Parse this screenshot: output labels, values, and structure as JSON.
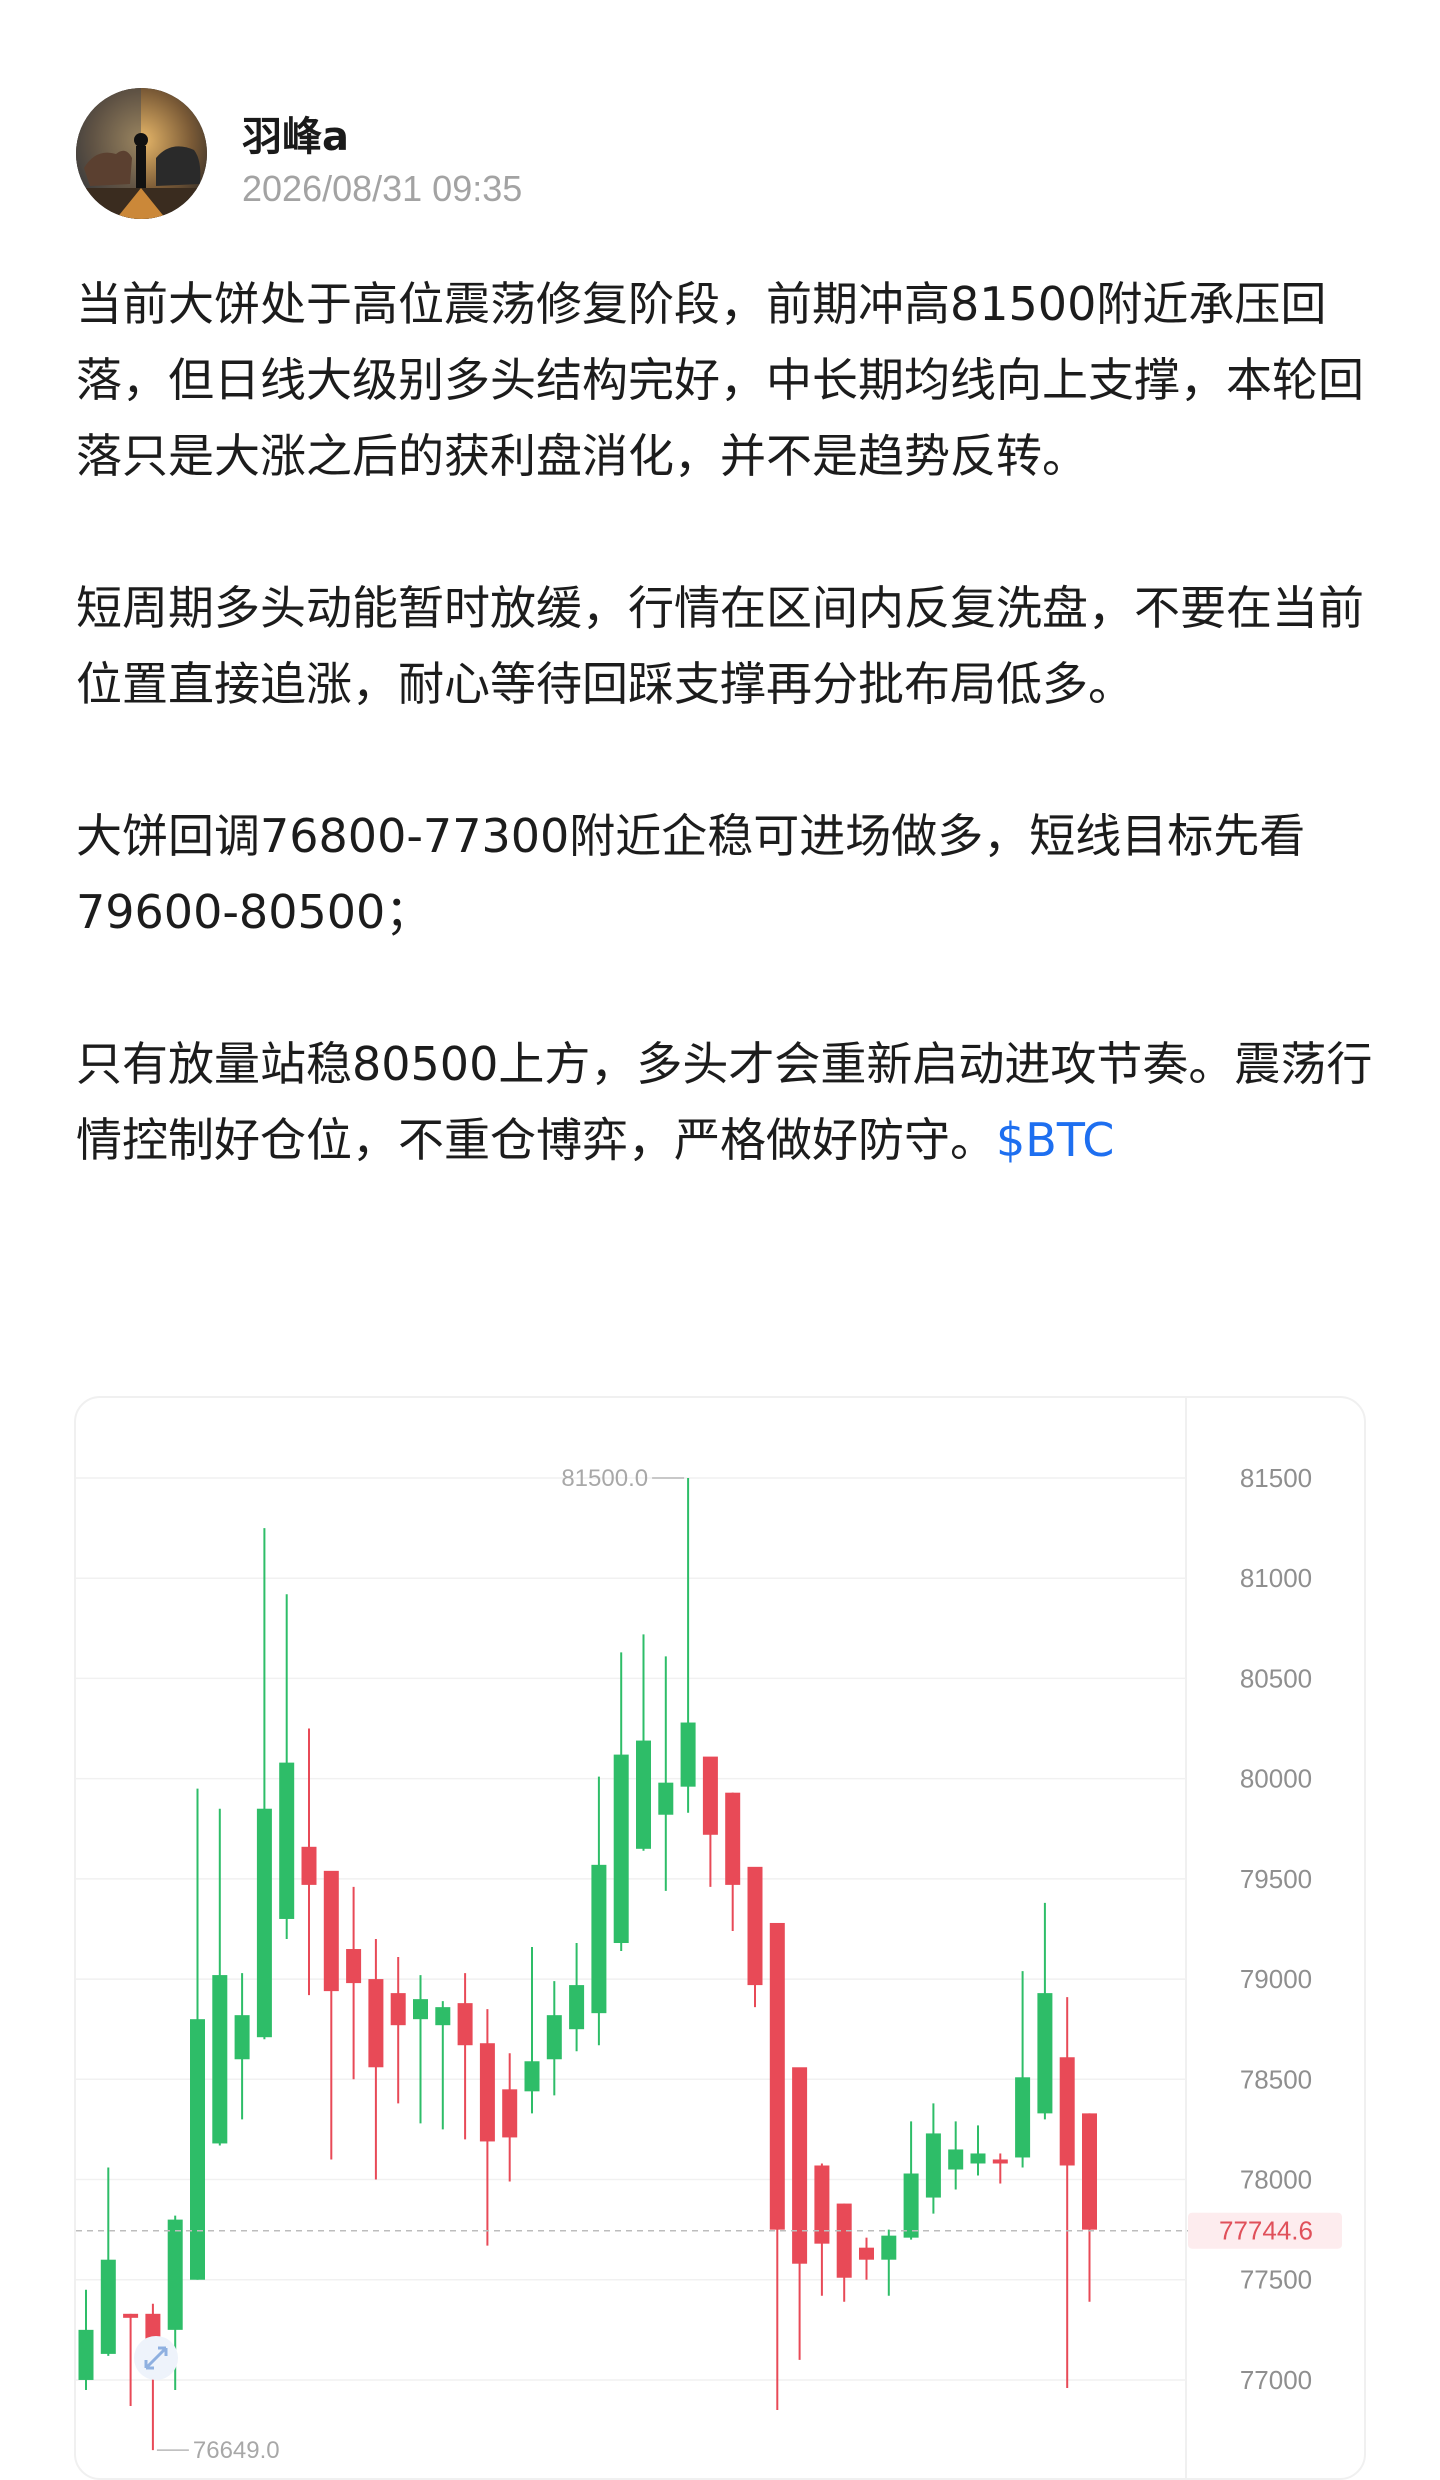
{
  "author": {
    "name": "羽峰a",
    "timestamp": "2026/08/31 09:35",
    "avatar_icon": "bull-and-bear-avatar"
  },
  "post": {
    "paragraphs": [
      "当前大饼处于高位震荡修复阶段，前期冲高81500附近承压回落，但日线大级别多头结构完好，中长期均线向上支撑，本轮回落只是大涨之后的获利盘消化，并不是趋势反转。",
      "短周期多头动能暂时放缓，行情在区间内反复洗盘，不要在当前位置直接追涨，耐心等待回踩支撑再分批布局低多。",
      "大饼回调76800-77300附近企稳可进场做多，短线目标先看79600-80500；",
      "只有放量站稳80500上方，多头才会重新启动进攻节奏。震荡行情控制好仓位，不重仓博弈，严格做好防守。"
    ],
    "tag": "$BTC"
  },
  "chart_data": {
    "type": "candlestick",
    "y_ticks": [
      "81500",
      "81000",
      "80500",
      "80000",
      "79500",
      "79000",
      "78500",
      "78000",
      "77500",
      "77000"
    ],
    "ylim": [
      76600,
      81700
    ],
    "high_marker": "81500.0",
    "low_marker": "76649.0",
    "last_price": "77744.6",
    "colors": {
      "up": "#2ebd68",
      "down": "#e84a57",
      "grid": "#f1f1f1",
      "last_line": "#bdbdbd"
    },
    "candles": [
      {
        "o": 77000,
        "h": 77450,
        "l": 76950,
        "c": 77250
      },
      {
        "o": 77130,
        "h": 78060,
        "l": 77120,
        "c": 77600
      },
      {
        "o": 77330,
        "h": 77330,
        "l": 76870,
        "c": 77310
      },
      {
        "o": 77330,
        "h": 77380,
        "l": 76650,
        "c": 77180
      },
      {
        "o": 77250,
        "h": 77820,
        "l": 76950,
        "c": 77800
      },
      {
        "o": 77500,
        "h": 79950,
        "l": 77500,
        "c": 78800
      },
      {
        "o": 78180,
        "h": 79850,
        "l": 78170,
        "c": 79020
      },
      {
        "o": 78600,
        "h": 79030,
        "l": 78300,
        "c": 78820
      },
      {
        "o": 78710,
        "h": 81250,
        "l": 78700,
        "c": 79850
      },
      {
        "o": 79300,
        "h": 80920,
        "l": 79200,
        "c": 80080
      },
      {
        "o": 79660,
        "h": 80250,
        "l": 78920,
        "c": 79470
      },
      {
        "o": 79540,
        "h": 79530,
        "l": 78100,
        "c": 78940
      },
      {
        "o": 79150,
        "h": 79460,
        "l": 78500,
        "c": 78980
      },
      {
        "o": 79000,
        "h": 79200,
        "l": 78000,
        "c": 78560
      },
      {
        "o": 78930,
        "h": 79110,
        "l": 78380,
        "c": 78770
      },
      {
        "o": 78800,
        "h": 79020,
        "l": 78280,
        "c": 78900
      },
      {
        "o": 78770,
        "h": 78890,
        "l": 78250,
        "c": 78860
      },
      {
        "o": 78880,
        "h": 79030,
        "l": 78200,
        "c": 78670
      },
      {
        "o": 78680,
        "h": 78850,
        "l": 77670,
        "c": 78190
      },
      {
        "o": 78450,
        "h": 78630,
        "l": 77990,
        "c": 78210
      },
      {
        "o": 78440,
        "h": 79160,
        "l": 78330,
        "c": 78590
      },
      {
        "o": 78600,
        "h": 78990,
        "l": 78420,
        "c": 78820
      },
      {
        "o": 78750,
        "h": 79180,
        "l": 78640,
        "c": 78970
      },
      {
        "o": 78830,
        "h": 80010,
        "l": 78670,
        "c": 79570
      },
      {
        "o": 79180,
        "h": 80630,
        "l": 79140,
        "c": 80120
      },
      {
        "o": 79650,
        "h": 80720,
        "l": 79640,
        "c": 80190
      },
      {
        "o": 79820,
        "h": 80610,
        "l": 79440,
        "c": 79980
      },
      {
        "o": 79960,
        "h": 81500,
        "l": 79830,
        "c": 80280
      },
      {
        "o": 80110,
        "h": 80100,
        "l": 79460,
        "c": 79720
      },
      {
        "o": 79930,
        "h": 79930,
        "l": 79240,
        "c": 79470
      },
      {
        "o": 79560,
        "h": 79480,
        "l": 78860,
        "c": 78970
      },
      {
        "o": 79280,
        "h": 79010,
        "l": 76850,
        "c": 77750
      },
      {
        "o": 78560,
        "h": 78530,
        "l": 77100,
        "c": 77580
      },
      {
        "o": 78070,
        "h": 78080,
        "l": 77420,
        "c": 77680
      },
      {
        "o": 77880,
        "h": 77880,
        "l": 77390,
        "c": 77510
      },
      {
        "o": 77660,
        "h": 77710,
        "l": 77500,
        "c": 77600
      },
      {
        "o": 77600,
        "h": 77750,
        "l": 77420,
        "c": 77720
      },
      {
        "o": 77710,
        "h": 78290,
        "l": 77700,
        "c": 78030
      },
      {
        "o": 77910,
        "h": 78380,
        "l": 77830,
        "c": 78230
      },
      {
        "o": 78050,
        "h": 78290,
        "l": 77950,
        "c": 78150
      },
      {
        "o": 78080,
        "h": 78270,
        "l": 78020,
        "c": 78130
      },
      {
        "o": 78100,
        "h": 78130,
        "l": 77980,
        "c": 78080
      },
      {
        "o": 78110,
        "h": 79040,
        "l": 78060,
        "c": 78510
      },
      {
        "o": 78330,
        "h": 79380,
        "l": 78300,
        "c": 78930
      },
      {
        "o": 78610,
        "h": 78910,
        "l": 76960,
        "c": 78070
      },
      {
        "o": 78330,
        "h": 78330,
        "l": 77390,
        "c": 77750
      }
    ]
  }
}
